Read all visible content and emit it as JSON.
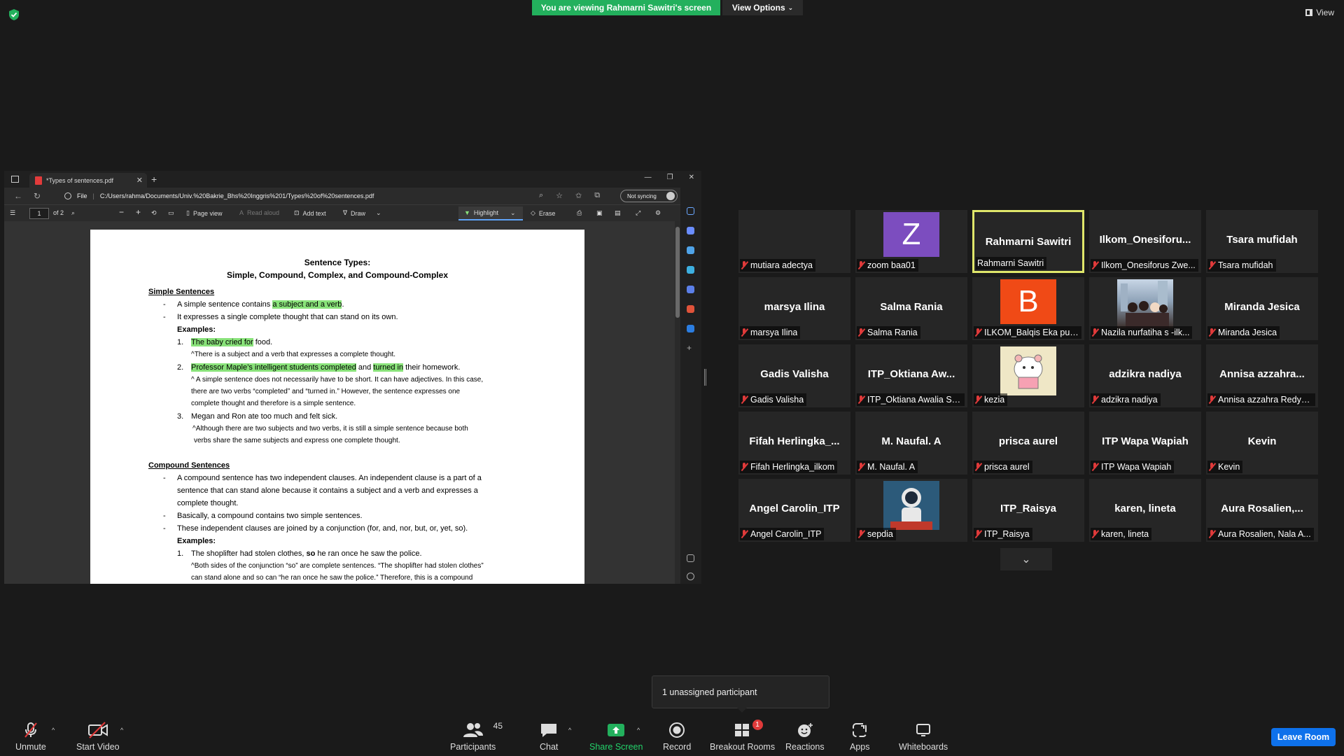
{
  "banner": {
    "viewing_text": "You are viewing Rahmarni Sawitri's screen",
    "view_options_label": "View Options",
    "view_label": "View"
  },
  "browser": {
    "tab_title": "*Types of sentences.pdf",
    "url_scheme": "File",
    "url": "C:/Users/rahma/Documents/Univ.%20Bakrie_Bhs%20Inggris%201/Types%20of%20sentences.pdf",
    "sync_label": "Not syncing"
  },
  "pdf_toolbar": {
    "page_number": "1",
    "page_total": "of 2",
    "zoom_out": "−",
    "zoom_in": "+",
    "page_view_label": "Page view",
    "read_aloud_label": "Read aloud",
    "add_text_label": "Add text",
    "draw_label": "Draw",
    "highlight_label": "Highlight",
    "erase_label": "Erase",
    "highlight_color": "#89e27a"
  },
  "document": {
    "title1": "Sentence Types:",
    "title2": "Simple, Compound, Complex, and Compound-Complex",
    "simple_heading": "Simple Sentences",
    "s_b1_a": "A simple sentence contains ",
    "s_b1_hl": "a subject and a verb",
    "s_b1_b": ".",
    "s_b2": "It expresses a single complete thought that can stand on its own.",
    "examples1": "Examples:",
    "ex1_num": "1.",
    "ex1_hl": "The baby cried for",
    "ex1_rest": " food.",
    "ex1_note": "^There is a subject and a verb that expresses a complete thought.",
    "ex2_num": "2.",
    "ex2_hl1": "Professor Maple’s intelligent students completed",
    "ex2_mid": " and ",
    "ex2_hl2": "turned in",
    "ex2_rest": " their homework.",
    "ex2_note1": "^ A simple sentence does not necessarily have to be short. It can have adjectives. In this case,",
    "ex2_note2": "there are two verbs “completed” and “turned in.” However, the sentence expresses one",
    "ex2_note3": "complete thought and therefore is a simple sentence.",
    "ex3_num": "3.",
    "ex3": "Megan and Ron ate too much and felt sick.",
    "ex3_note1": "^Although there are two subjects and two verbs, it is still a simple sentence because both",
    "ex3_note2": "verbs share the same subjects and express one complete thought.",
    "compound_heading": "Compound Sentences",
    "c_b1_1": "A compound sentence has two independent clauses. An independent clause is a part of a",
    "c_b1_2": "sentence that can stand alone because it contains a subject and a verb and expresses a",
    "c_b1_3": "complete thought.",
    "c_b2": "Basically, a compound contains two simple sentences.",
    "c_b3": "These independent clauses are joined by a conjunction (for, and, nor, but, or, yet, so).",
    "examples2": "Examples:",
    "cex1_num": "1.",
    "cex1_a": "The shoplifter had stolen clothes, ",
    "cex1_so": "so",
    "cex1_b": " he ran once he saw the police.",
    "cex1_note1": "^Both sides of the conjunction “so” are complete sentences. “The shoplifter had stolen clothes”",
    "cex1_note2": "can stand alone and so can “he ran once he saw the police.” Therefore, this is a compound"
  },
  "participants": [
    {
      "big": "",
      "label": "mutiara adectya",
      "avatar": "none"
    },
    {
      "big": "",
      "label": "zoom baa01",
      "avatar": "letter",
      "letter": "Z",
      "color": "#7c4dbf"
    },
    {
      "big": "Rahmarni Sawitri",
      "label": "Rahmarni Sawitri",
      "avatar": "none",
      "active": true,
      "muted": false
    },
    {
      "big": "Ilkom_Onesiforu...",
      "label": "Ilkom_Onesiforus Zwe...",
      "avatar": "none"
    },
    {
      "big": "Tsara mufidah",
      "label": "Tsara mufidah",
      "avatar": "none"
    },
    {
      "big": "marsya Ilina",
      "label": "marsya Ilina",
      "avatar": "none"
    },
    {
      "big": "Salma Rania",
      "label": "Salma Rania",
      "avatar": "none"
    },
    {
      "big": "",
      "label": "ILKOM_Balqis Eka putry",
      "avatar": "letter",
      "letter": "B",
      "color": "#f04a16"
    },
    {
      "big": "",
      "label": "Nazila nurfatiha s -ilk...",
      "avatar": "photo-group"
    },
    {
      "big": "Miranda Jesica",
      "label": "Miranda Jesica",
      "avatar": "none"
    },
    {
      "big": "Gadis Valisha",
      "label": "Gadis Valisha",
      "avatar": "none"
    },
    {
      "big": "ITP_Oktiana  Aw...",
      "label": "ITP_Oktiana Awalia Sy...",
      "avatar": "none"
    },
    {
      "big": "",
      "label": "kezia",
      "avatar": "photo-hamster"
    },
    {
      "big": "adzikra nadiya",
      "label": "adzikra nadiya",
      "avatar": "none"
    },
    {
      "big": "Annisa  azzahra...",
      "label": "Annisa azzahra Redy_...",
      "avatar": "none"
    },
    {
      "big": "Fifah  Herlingka_...",
      "label": "Fifah Herlingka_ilkom",
      "avatar": "none"
    },
    {
      "big": "M. Naufal. A",
      "label": "M. Naufal. A",
      "avatar": "none"
    },
    {
      "big": "prisca aurel",
      "label": "prisca aurel",
      "avatar": "none"
    },
    {
      "big": "ITP Wapa Wapiah",
      "label": "ITP Wapa Wapiah",
      "avatar": "none"
    },
    {
      "big": "Kevin",
      "label": "Kevin",
      "avatar": "none"
    },
    {
      "big": "Angel Carolin_ITP",
      "label": "Angel Carolin_ITP",
      "avatar": "none"
    },
    {
      "big": "",
      "label": "sepdia",
      "avatar": "photo-astronaut"
    },
    {
      "big": "ITP_Raisya",
      "label": "ITP_Raisya",
      "avatar": "none"
    },
    {
      "big": "karen, lineta",
      "label": "karen, lineta",
      "avatar": "none"
    },
    {
      "big": "Aura  Rosalien,...",
      "label": "Aura Rosalien, Nala A...",
      "avatar": "none"
    }
  ],
  "tooltip": {
    "text": "1 unassigned participant"
  },
  "controls": {
    "unmute": "Unmute",
    "start_video": "Start Video",
    "participants": "Participants",
    "participants_count": "45",
    "chat": "Chat",
    "share_screen": "Share Screen",
    "record": "Record",
    "breakout_rooms": "Breakout Rooms",
    "breakout_badge": "1",
    "reactions": "Reactions",
    "apps": "Apps",
    "whiteboards": "Whiteboards",
    "leave": "Leave Room"
  },
  "colors": {
    "share_green": "#23b05d",
    "active_speaker": "#dfe66a",
    "leave_blue": "#0e71eb",
    "muted_red": "#e03a3a"
  }
}
